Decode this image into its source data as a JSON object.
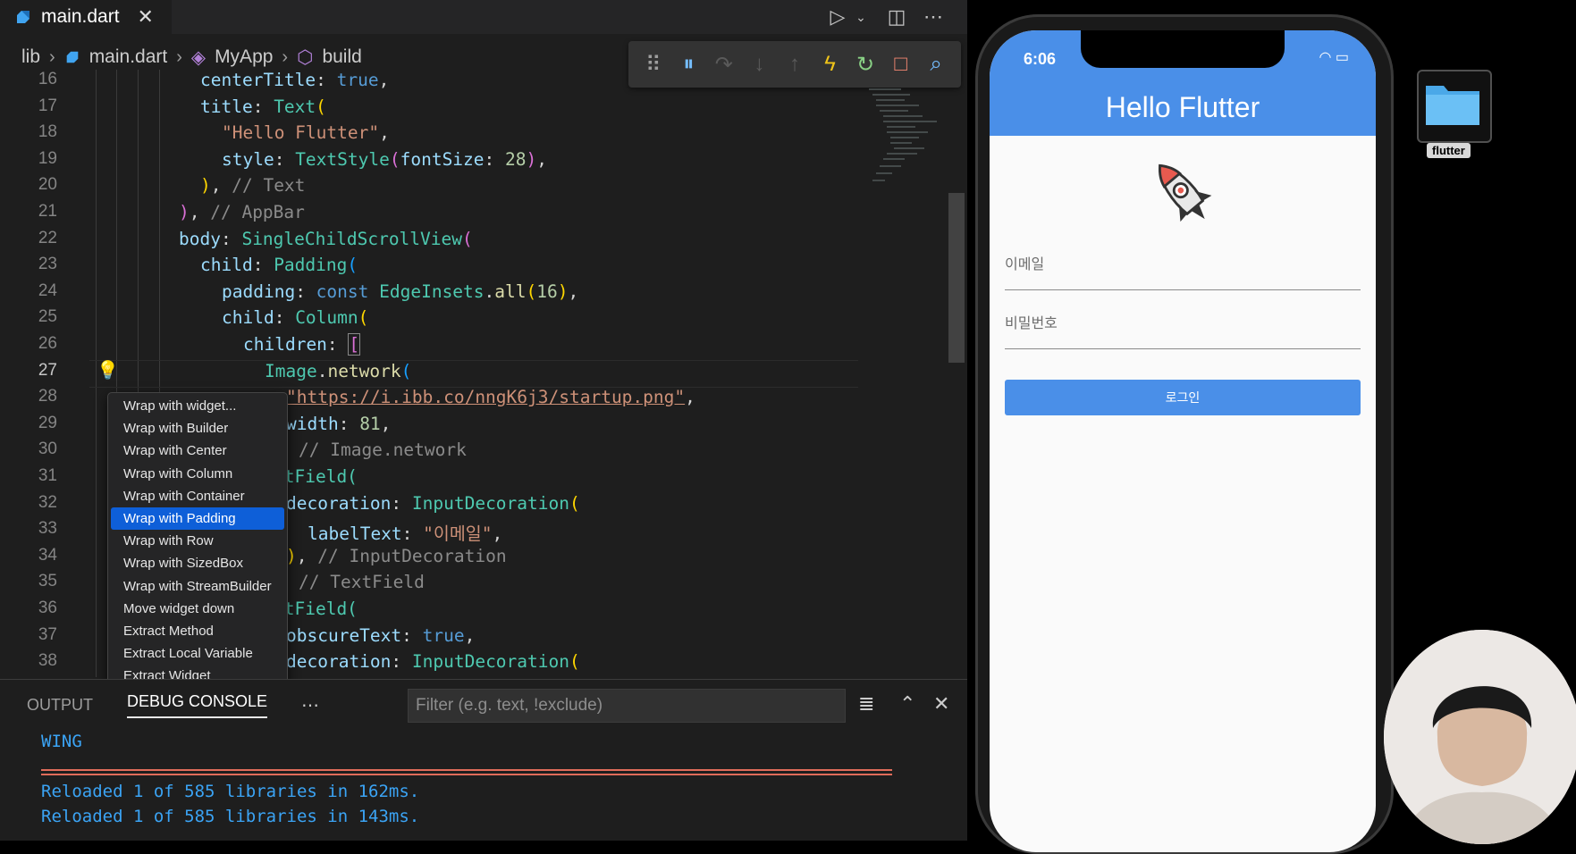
{
  "editor": {
    "tab_title": "main.dart",
    "breadcrumb": [
      "lib",
      "main.dart",
      "MyApp",
      "build"
    ],
    "line_numbers": [
      "16",
      "17",
      "18",
      "19",
      "20",
      "21",
      "22",
      "23",
      "24",
      "25",
      "26",
      "27",
      "28",
      "29",
      "30",
      "31",
      "32",
      "33",
      "34",
      "35",
      "36",
      "37",
      "38"
    ],
    "code": {
      "l16_a": "centerTitle",
      "l16_b": "true",
      "l17_a": "title",
      "l17_b": "Text",
      "l18": "\"Hello Flutter\"",
      "l19_a": "style",
      "l19_b": "TextStyle",
      "l19_c": "fontSize",
      "l19_d": "28",
      "l20": "// Text",
      "l21": "// AppBar",
      "l22_a": "body",
      "l22_b": "SingleChildScrollView",
      "l23_a": "child",
      "l23_b": "Padding",
      "l24_a": "padding",
      "l24_b": "const",
      "l24_c": "EdgeInsets",
      "l24_d": "all",
      "l24_e": "16",
      "l25_a": "child",
      "l25_b": "Column",
      "l26_a": "children",
      "l27_a": "Image",
      "l27_b": "network",
      "l28": "\"https://i.ibb.co/nngK6j3/startup.png\"",
      "l29_a": "width",
      "l29_b": "81",
      "l30": "// Image.network",
      "l31": "xtField(",
      "l32_a": "decoration",
      "l32_b": "InputDecoration",
      "l33_a": "labelText",
      "l33_b": "\"이메일\"",
      "l34": "// InputDecoration",
      "l35": "// TextField",
      "l36": "xtField(",
      "l37_a": "obscureText",
      "l37_b": "true",
      "l38_a": "decoration",
      "l38_b": "InputDecoration"
    },
    "context_menu": [
      "Wrap with widget...",
      "Wrap with Builder",
      "Wrap with Center",
      "Wrap with Column",
      "Wrap with Container",
      "Wrap with Padding",
      "Wrap with Row",
      "Wrap with SizedBox",
      "Wrap with StreamBuilder",
      "Move widget down",
      "Extract Method",
      "Extract Local Variable",
      "Extract Widget"
    ],
    "selected_menu_item": "Wrap with Padding"
  },
  "panel": {
    "tab_output": "OUTPUT",
    "tab_debug_console": "DEBUG CONSOLE",
    "filter_placeholder": "Filter (e.g. text, !exclude)",
    "console_lines": [
      "WING",
      "Reloaded 1 of 585 libraries in 162ms.",
      "Reloaded 1 of 585 libraries in 143ms."
    ]
  },
  "phone": {
    "time": "6:06",
    "app_title": "Hello Flutter",
    "email_label": "이메일",
    "password_label": "비밀번호",
    "login_button": "로그인"
  },
  "desktop": {
    "folder_label": "flutter"
  },
  "icons": {
    "tab": "dart-icon",
    "run": "play-icon",
    "split": "split-editor-icon",
    "more": "more-icon",
    "debug": [
      "drag-handle-icon",
      "pause-icon",
      "step-over-icon",
      "step-into-icon",
      "step-out-icon",
      "hot-reload-icon",
      "restart-icon",
      "stop-icon",
      "devtools-icon"
    ]
  },
  "colors": {
    "accent": "#0e5fd8",
    "appbar": "#4a8fe8",
    "console_text": "#3ba4f5"
  }
}
